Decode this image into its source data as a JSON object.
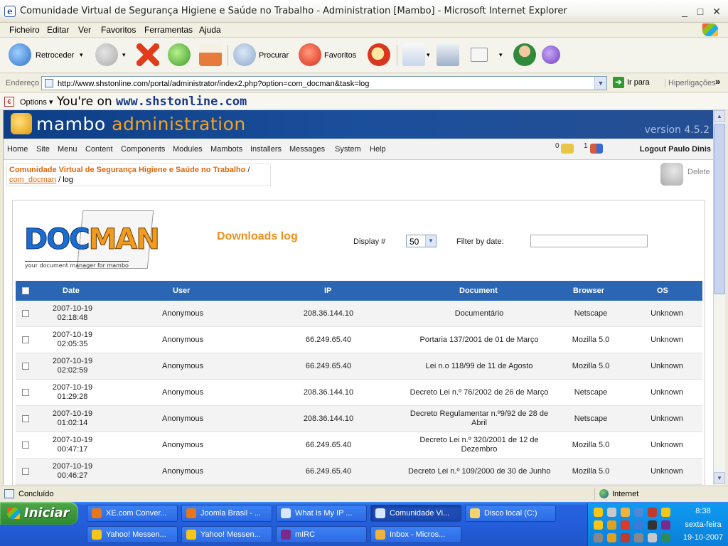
{
  "window": {
    "title": "Comunidade Virtual de Segurança Higiene e Saúde no Trabalho - Administration [Mambo] - Microsoft Internet Explorer",
    "minimize": "_",
    "maximize": "□",
    "close": "✕"
  },
  "menu": [
    "Ficheiro",
    "Editar",
    "Ver",
    "Favoritos",
    "Ferramentas",
    "Ajuda"
  ],
  "toolbar": {
    "back": "Retroceder",
    "search": "Procurar",
    "favorites": "Favoritos",
    "dropdown": "▾"
  },
  "address": {
    "label": "Endereço",
    "url": "http://www.shstonline.com/portal/administrator/index2.php?option=com_docman&task=log",
    "go": "Ir para",
    "links": "Hiperligações",
    "more": "»"
  },
  "linksbar": {
    "options": "Options ▾",
    "message_prefix": "You're on ",
    "message_site": "www.shstonline.com"
  },
  "mambo": {
    "brand1": "mambo ",
    "brand2": "administration",
    "version": "version 4.5.2",
    "nav": [
      "Home",
      "Site",
      "Menu",
      "Content",
      "Components",
      "Modules",
      "Mambots",
      "Installers",
      "Messages",
      "System",
      "Help"
    ],
    "messages_count": "0",
    "users_count": "1",
    "logout": "Logout Paulo Dinis"
  },
  "breadcrumb": {
    "site": "Comunidade Virtual de Segurança Higiene e Saúde no Trabalho",
    "sep": " /",
    "component": "com_docman",
    "page": " / log"
  },
  "delete_label": "Delete",
  "docman": {
    "logo_d": "DOC",
    "logo_m": "MAN",
    "tagline": "your document manager for mambo"
  },
  "page": {
    "title": "Downloads log",
    "display_label": "Display #",
    "display_value": "50",
    "filter_label": "Filter by date:",
    "filter_value": ""
  },
  "table": {
    "columns": [
      "Date",
      "User",
      "IP",
      "Document",
      "Browser",
      "OS"
    ],
    "rows": [
      {
        "date": "2007-10-19",
        "time": "02:18:48",
        "user": "Anonymous",
        "ip": "208.36.144.10",
        "doc1": "Documentário",
        "doc2": "",
        "browser": "Netscape",
        "os": "Unknown"
      },
      {
        "date": "2007-10-19",
        "time": "02:05:35",
        "user": "Anonymous",
        "ip": "66.249.65.40",
        "doc1": "Portaria 137/2001 de 01 de Março",
        "doc2": "",
        "browser": "Mozilla 5.0",
        "os": "Unknown"
      },
      {
        "date": "2007-10-19",
        "time": "02:02:59",
        "user": "Anonymous",
        "ip": "66.249.65.40",
        "doc1": "Lei n.o 118/99 de 11 de Agosto",
        "doc2": "",
        "browser": "Mozilla 5.0",
        "os": "Unknown"
      },
      {
        "date": "2007-10-19",
        "time": "01:29:28",
        "user": "Anonymous",
        "ip": "208.36.144.10",
        "doc1": "Decreto Lei n.º 76/2002 de 26 de Março",
        "doc2": "",
        "browser": "Netscape",
        "os": "Unknown"
      },
      {
        "date": "2007-10-19",
        "time": "01:02:14",
        "user": "Anonymous",
        "ip": "208.36.144.10",
        "doc1": "Decreto Regulamentar n.º9/92 de 28 de",
        "doc2": "Abril",
        "browser": "Netscape",
        "os": "Unknown"
      },
      {
        "date": "2007-10-19",
        "time": "00:47:17",
        "user": "Anonymous",
        "ip": "66.249.65.40",
        "doc1": "Decreto Lei n.º 320/2001 de 12 de",
        "doc2": "Dezembro",
        "browser": "Mozilla 5.0",
        "os": "Unknown"
      },
      {
        "date": "2007-10-19",
        "time": "00:46:27",
        "user": "Anonymous",
        "ip": "66.249.65.40",
        "doc1": "Decreto Lei n.º 109/2000 de 30 de Junho",
        "doc2": "",
        "browser": "Mozilla 5.0",
        "os": "Unknown"
      }
    ]
  },
  "status": {
    "text": "Concluído",
    "zone": "Internet"
  },
  "taskbar": {
    "start": "Iniciar",
    "tasks": [
      {
        "label": "XE.com Conver...",
        "icon": "firefox-icon",
        "color": "#e8761b"
      },
      {
        "label": "Joomla Brasil - ...",
        "icon": "firefox-icon",
        "color": "#e8761b"
      },
      {
        "label": "What Is My IP ...",
        "icon": "ie-icon",
        "color": "#d8e6ff"
      },
      {
        "label": "Comunidade Vi...",
        "icon": "ie-icon",
        "color": "#d8e6ff"
      },
      {
        "label": "Disco local (C:)",
        "icon": "folder-icon",
        "color": "#f4d46a"
      },
      {
        "label": "Yahoo! Messen...",
        "icon": "yahoo-icon",
        "color": "#f5c518"
      },
      {
        "label": "Yahoo! Messen...",
        "icon": "yahoo-icon",
        "color": "#f5c518"
      },
      {
        "label": "mIRC",
        "icon": "mirc-icon",
        "color": "#7b2a8a"
      },
      {
        "label": "Inbox - Micros...",
        "icon": "outlook-icon",
        "color": "#f0b23c"
      }
    ],
    "clock_time": "8:38",
    "clock_day": "sexta-feira",
    "clock_date": "19-10-2007"
  }
}
